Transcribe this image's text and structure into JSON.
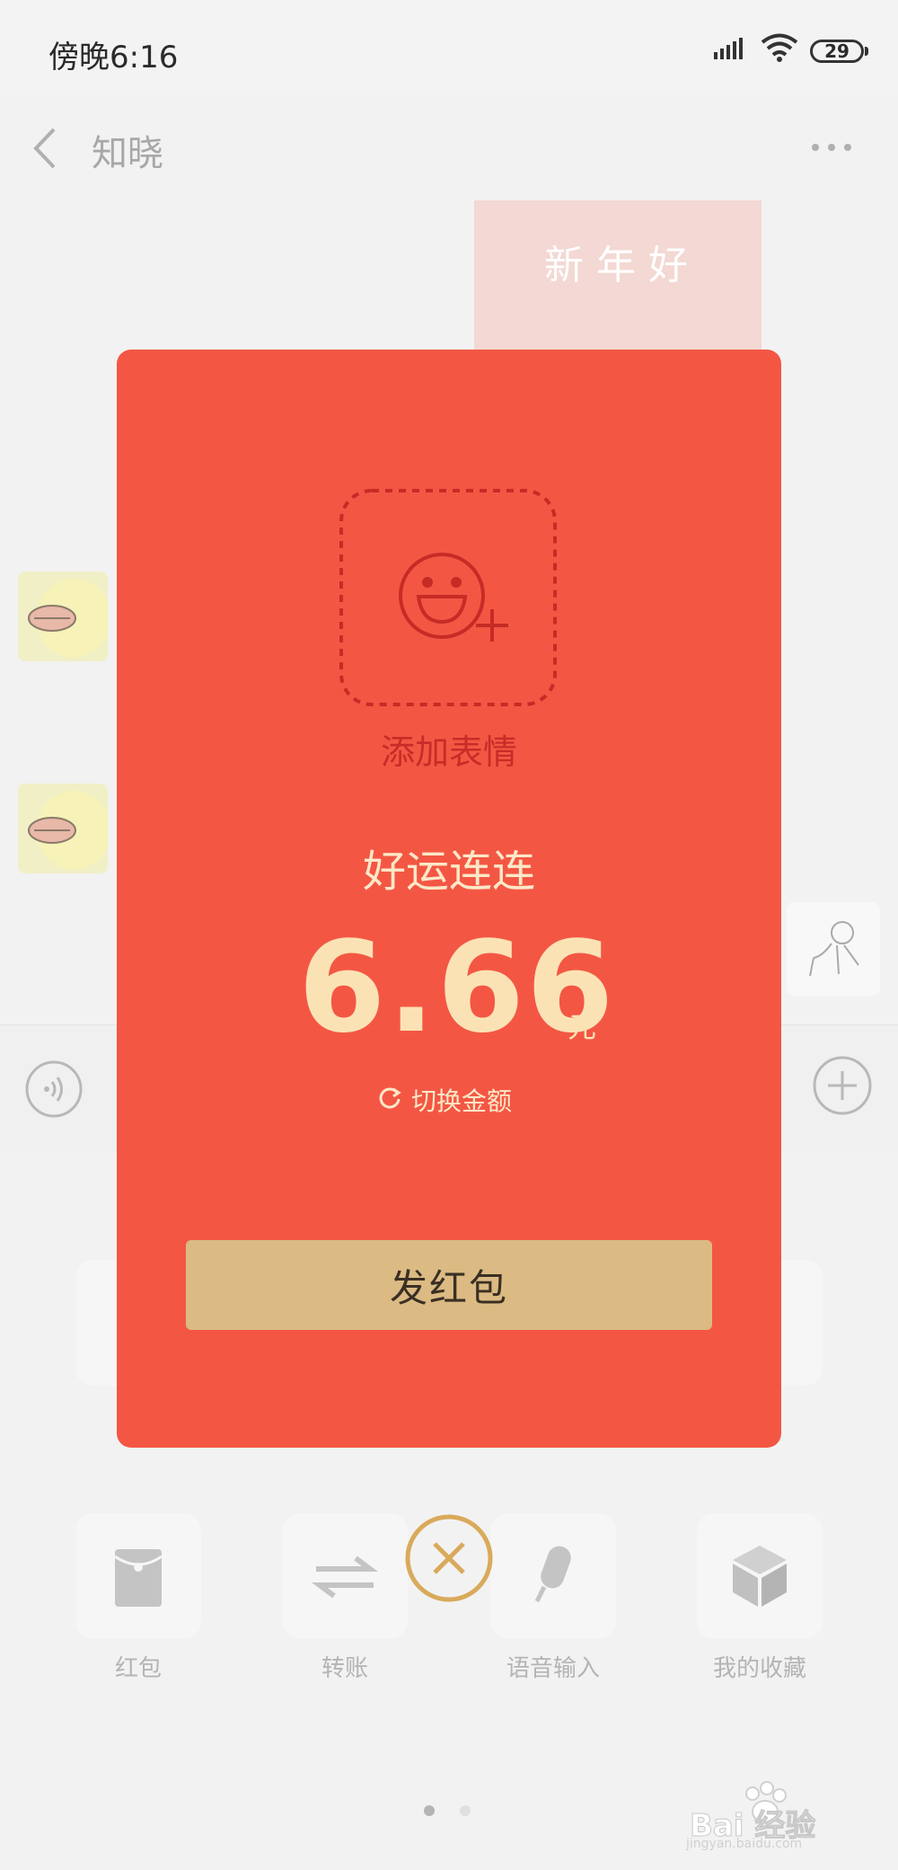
{
  "status_bar": {
    "time": "傍晚6:16",
    "battery": "29"
  },
  "chat": {
    "title": "知晓",
    "sticker_text": "新年好"
  },
  "panel": {
    "items": [
      {
        "label": "红包",
        "icon": "red-packet-icon"
      },
      {
        "label": "转账",
        "icon": "transfer-icon"
      },
      {
        "label": "语音输入",
        "icon": "microphone-icon"
      },
      {
        "label": "我的收藏",
        "icon": "cube-icon"
      }
    ]
  },
  "red_packet": {
    "add_emoji_label": "添加表情",
    "blessing": "好运连连",
    "amount": "6.66",
    "unit": "元",
    "switch_label": "切换金额",
    "send_label": "发红包"
  },
  "watermark": {
    "text": "Bai 经验",
    "sub": "jingyan.baidu.com"
  },
  "colors": {
    "envelope_red": "#f35744",
    "button_gold": "#dbbb83",
    "amount_cream": "#fbe2b5",
    "close_ring": "#d9aa5a"
  }
}
